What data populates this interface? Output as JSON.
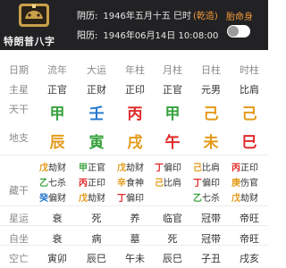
{
  "header": {
    "app_name": "特朗普八字",
    "lunar_label": "阴历:",
    "lunar_value": "1946年五月十五 巳时",
    "lunar_hint": "(乾造)",
    "solar_label": "阳历:",
    "solar_value": "1946年06月14日 10:08:00",
    "save_label": "胎命身",
    "toggle_on": false
  },
  "row_labels": [
    "日期",
    "主星",
    "天干",
    "地支",
    "藏干",
    "星运",
    "自坐",
    "空亡"
  ],
  "columns": [
    {
      "header": "流年",
      "star": "正官",
      "stem": "甲",
      "stem_color": "#37a23d",
      "branch": "辰",
      "branch_color": "#e39a1a",
      "hidden": [
        {
          "c": "戊",
          "s": "劫财",
          "color": "#e39a1a"
        },
        {
          "c": "乙",
          "s": "七杀",
          "color": "#37a23d"
        },
        {
          "c": "癸",
          "s": "偏财",
          "color": "#2277cf"
        }
      ],
      "xingyun": "衰",
      "zizuo": "衰",
      "kongwang": "寅卯"
    },
    {
      "header": "大运",
      "star": "正财",
      "stem": "壬",
      "stem_color": "#2277cf",
      "branch": "寅",
      "branch_color": "#37a23d",
      "hidden": [
        {
          "c": "甲",
          "s": "正官",
          "color": "#37a23d"
        },
        {
          "c": "丙",
          "s": "正印",
          "color": "#e02a2a"
        },
        {
          "c": "戊",
          "s": "劫财",
          "color": "#e39a1a"
        }
      ],
      "xingyun": "死",
      "zizuo": "病",
      "kongwang": "辰巳"
    },
    {
      "header": "年柱",
      "star": "正印",
      "stem": "丙",
      "stem_color": "#e02a2a",
      "branch": "戌",
      "branch_color": "#e39a1a",
      "hidden": [
        {
          "c": "戊",
          "s": "劫财",
          "color": "#e39a1a"
        },
        {
          "c": "辛",
          "s": "食神",
          "color": "#e39a1a"
        },
        {
          "c": "丁",
          "s": "偏印",
          "color": "#e02a2a"
        }
      ],
      "xingyun": "养",
      "zizuo": "墓",
      "kongwang": "午未"
    },
    {
      "header": "月柱",
      "star": "正官",
      "stem": "甲",
      "stem_color": "#37a23d",
      "branch": "午",
      "branch_color": "#e02a2a",
      "hidden": [
        {
          "c": "丁",
          "s": "偏印",
          "color": "#e02a2a"
        },
        {
          "c": "己",
          "s": "比肩",
          "color": "#e39a1a"
        }
      ],
      "xingyun": "临官",
      "zizuo": "死",
      "kongwang": "辰巳"
    },
    {
      "header": "日柱",
      "star": "元男",
      "stem": "己",
      "stem_color": "#e39a1a",
      "branch": "未",
      "branch_color": "#e39a1a",
      "hidden": [
        {
          "c": "己",
          "s": "比肩",
          "color": "#e39a1a"
        },
        {
          "c": "丁",
          "s": "偏印",
          "color": "#e02a2a"
        },
        {
          "c": "乙",
          "s": "七杀",
          "color": "#37a23d"
        }
      ],
      "xingyun": "冠带",
      "zizuo": "冠带",
      "kongwang": "子丑"
    },
    {
      "header": "时柱",
      "star": "比肩",
      "stem": "己",
      "stem_color": "#e39a1a",
      "branch": "巳",
      "branch_color": "#e02a2a",
      "hidden": [
        {
          "c": "丙",
          "s": "正印",
          "color": "#e02a2a"
        },
        {
          "c": "庚",
          "s": "伤官",
          "color": "#e39a1a"
        },
        {
          "c": "戊",
          "s": "劫财",
          "color": "#e39a1a"
        }
      ],
      "xingyun": "帝旺",
      "zizuo": "帝旺",
      "kongwang": "戌亥"
    }
  ]
}
